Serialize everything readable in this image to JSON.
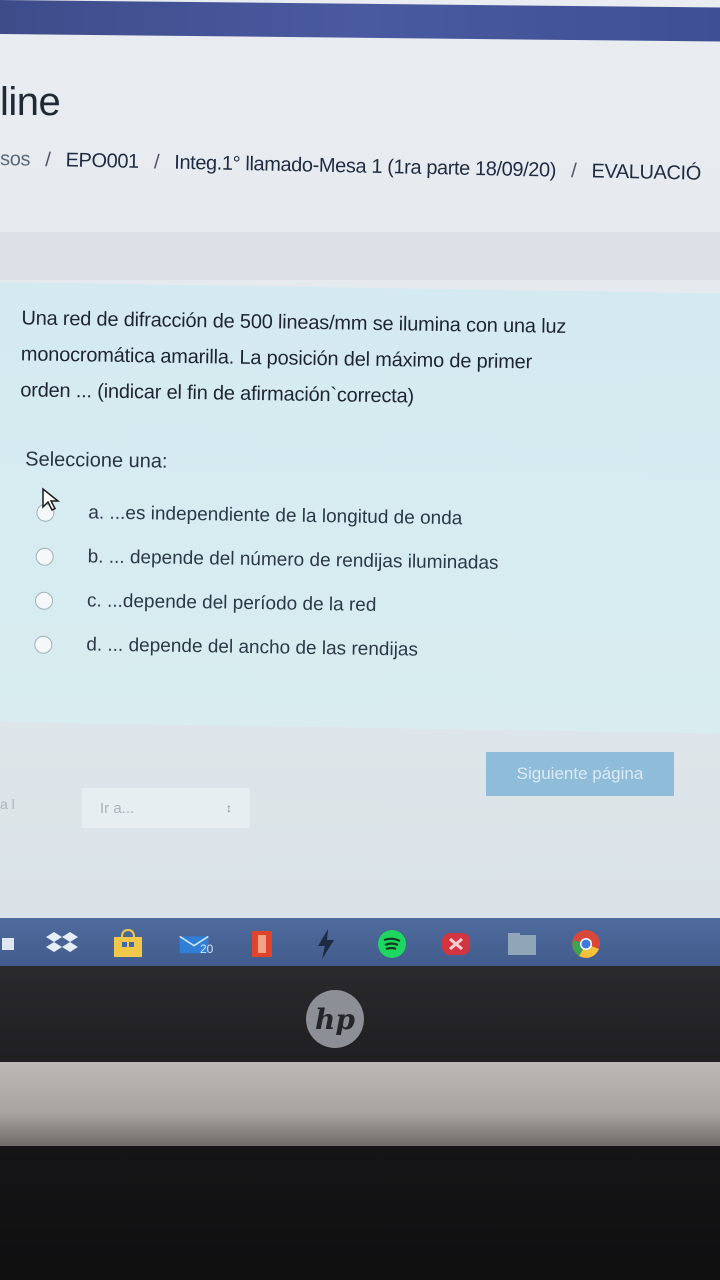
{
  "site": {
    "title_fragment": "line"
  },
  "breadcrumb": {
    "items": [
      "sos",
      "EPO001",
      "Integ.1° llamado-Mesa 1 (1ra parte 18/09/20)",
      "EVALUACIÓ"
    ],
    "separator": "/"
  },
  "question": {
    "text_lines": [
      "Una red de difracción de 500 lineas/mm se ilumina con una luz",
      "monocromática amarilla. La posición del máximo de primer",
      "orden ... (indicar el fin de afirmación`correcta)"
    ],
    "select_label": "Seleccione una:",
    "options": [
      "a. ...es independiente de la longitud de onda",
      "b. ... depende del número de rendijas iluminadas",
      "c. ...depende del período de la red",
      "d. ... depende del ancho de las rendijas"
    ]
  },
  "navigation": {
    "next_label": "Siguiente página",
    "prev_fragment": "a l",
    "goto_placeholder": "Ir a..."
  },
  "taskbar": {
    "badge": "20",
    "icons": [
      "dropbox-icon",
      "store-icon",
      "mail-icon",
      "office-icon",
      "bolt-icon",
      "spotify-icon",
      "game-icon",
      "folder-icon",
      "chrome-icon"
    ]
  },
  "device": {
    "brand": "hp"
  },
  "colors": {
    "question_bg": "#d6ecf1",
    "next_button": "#8fbcd8",
    "taskbar": "#4a6496"
  }
}
